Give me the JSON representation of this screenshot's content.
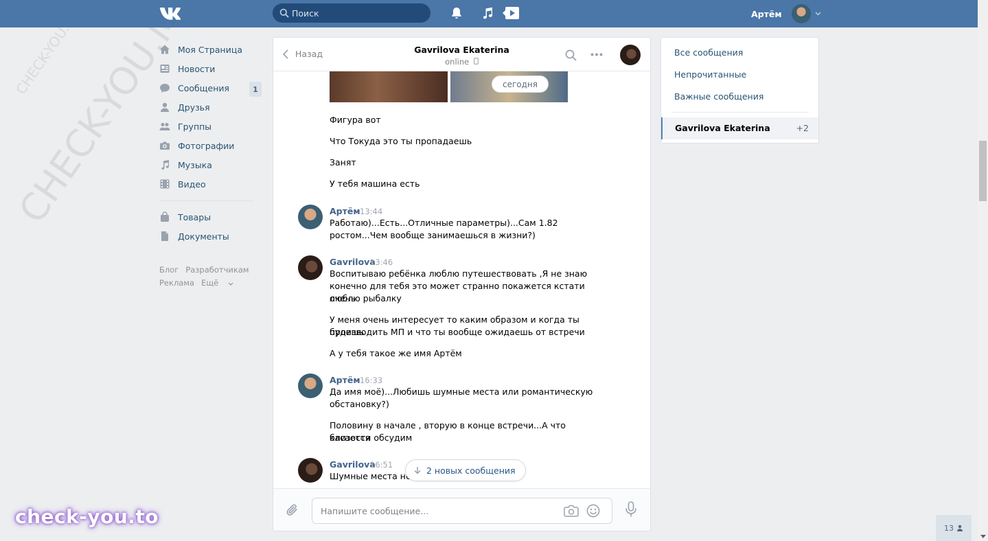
{
  "topbar": {
    "search_placeholder": "Поиск",
    "user_name": "Артём"
  },
  "leftnav": {
    "items": [
      {
        "label": "Моя Страница",
        "icon": "home-icon"
      },
      {
        "label": "Новости",
        "icon": "news-icon"
      },
      {
        "label": "Сообщения",
        "icon": "messages-icon",
        "count": "1"
      },
      {
        "label": "Друзья",
        "icon": "friends-icon"
      },
      {
        "label": "Группы",
        "icon": "groups-icon"
      },
      {
        "label": "Фотографии",
        "icon": "camera-icon"
      },
      {
        "label": "Музыка",
        "icon": "music-icon"
      },
      {
        "label": "Видео",
        "icon": "video-icon"
      },
      {
        "label": "Товары",
        "icon": "bag-icon"
      },
      {
        "label": "Документы",
        "icon": "document-icon"
      }
    ],
    "footer": [
      "Блог",
      "Разработчикам",
      "Реклама",
      "Ещё"
    ]
  },
  "chat": {
    "back_label": "Назад",
    "peer_name": "Gavrilova Ekaterina",
    "peer_status": "online",
    "date_divider": "сегодня",
    "incoming_lines": [
      "Фигура вот",
      "Что Токуда это ты пропадаешь",
      "Занят",
      "У тебя машина есть"
    ],
    "messages": [
      {
        "author": "Артём",
        "time": "13:44",
        "lines": [
          "Работаю)...Есть...Отличные параметры)...Сам 1.82",
          "ростом...Чем вообще занимаешься в жизни?)"
        ]
      },
      {
        "author": "Gavrilova",
        "time": "13:46",
        "lines": [
          "Воспитываю ребёнка люблю путешествовать ,Я не знаю",
          "конечно для тебя это может странно покажется кстати очень",
          "люблю рыбалку",
          "У меня очень интересует то каким образом и когда ты будешь",
          "производить МП и что ты вообще ожидаешь от встречи",
          "А у тебя такое же имя Артём"
        ]
      },
      {
        "author": "Артём",
        "time": "16:33",
        "lines": [
          "Да имя моё)...Любишь шумные места или романтическую",
          "обстановку?)",
          "Половину в начале , вторую в конце встречи...А что касается",
          "близости обсудим"
        ]
      },
      {
        "author": "Gavrilova",
        "time": "16:51",
        "lines": [
          "Шумные места не"
        ]
      }
    ],
    "new_messages_label": "2 новых сообщения",
    "composer_placeholder": "Напишите сообщение..."
  },
  "rightpanel": {
    "items": [
      "Все сообщения",
      "Непрочитанные",
      "Важные сообщения"
    ],
    "active_name": "Gavrilova Ekaterina",
    "active_count": "+2"
  },
  "online_count": "13",
  "watermarks": {
    "large": "CHECK-YOU.ME",
    "small": "CHECK-YOU.ME",
    "brand": "check-you.to"
  },
  "colors": {
    "header": "#4a76a8",
    "link": "#2a5885",
    "accent": "#5181b8",
    "background": "#edeef0"
  }
}
